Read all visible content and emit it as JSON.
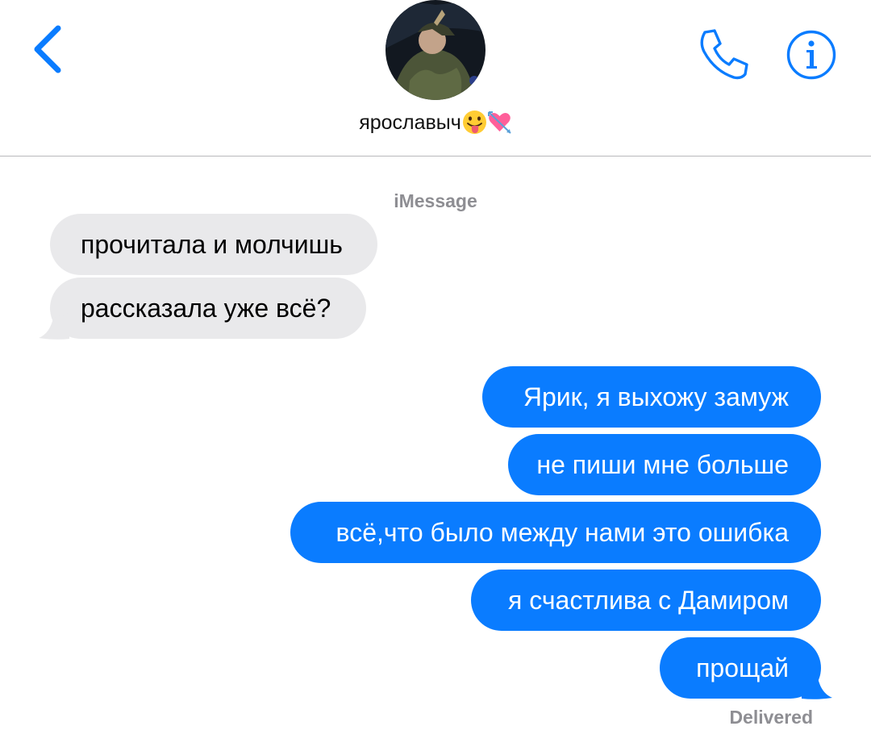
{
  "header": {
    "contact_name": "ярославыч",
    "name_emojis": [
      "tongue-out-emoji",
      "heart-with-arrow-emoji"
    ],
    "back_icon": "chevron-left-icon",
    "call_icon": "phone-icon",
    "info_icon": "info-icon"
  },
  "thread": {
    "service_label": "iMessage",
    "incoming": [
      {
        "text": "прочитала и молчишь"
      },
      {
        "text": "рассказала уже всё?"
      }
    ],
    "outgoing": [
      {
        "text": "Ярик, я выхожу замуж"
      },
      {
        "text": "не пиши мне больше"
      },
      {
        "text": "всё,что было между нами это ошибка"
      },
      {
        "text": "я счастлива с Дамиром"
      },
      {
        "text": "прощай"
      }
    ],
    "status": "Delivered"
  },
  "colors": {
    "accent": "#0a7cff",
    "incoming_bubble": "#e9e9eb",
    "meta_text": "#8e8e93"
  }
}
